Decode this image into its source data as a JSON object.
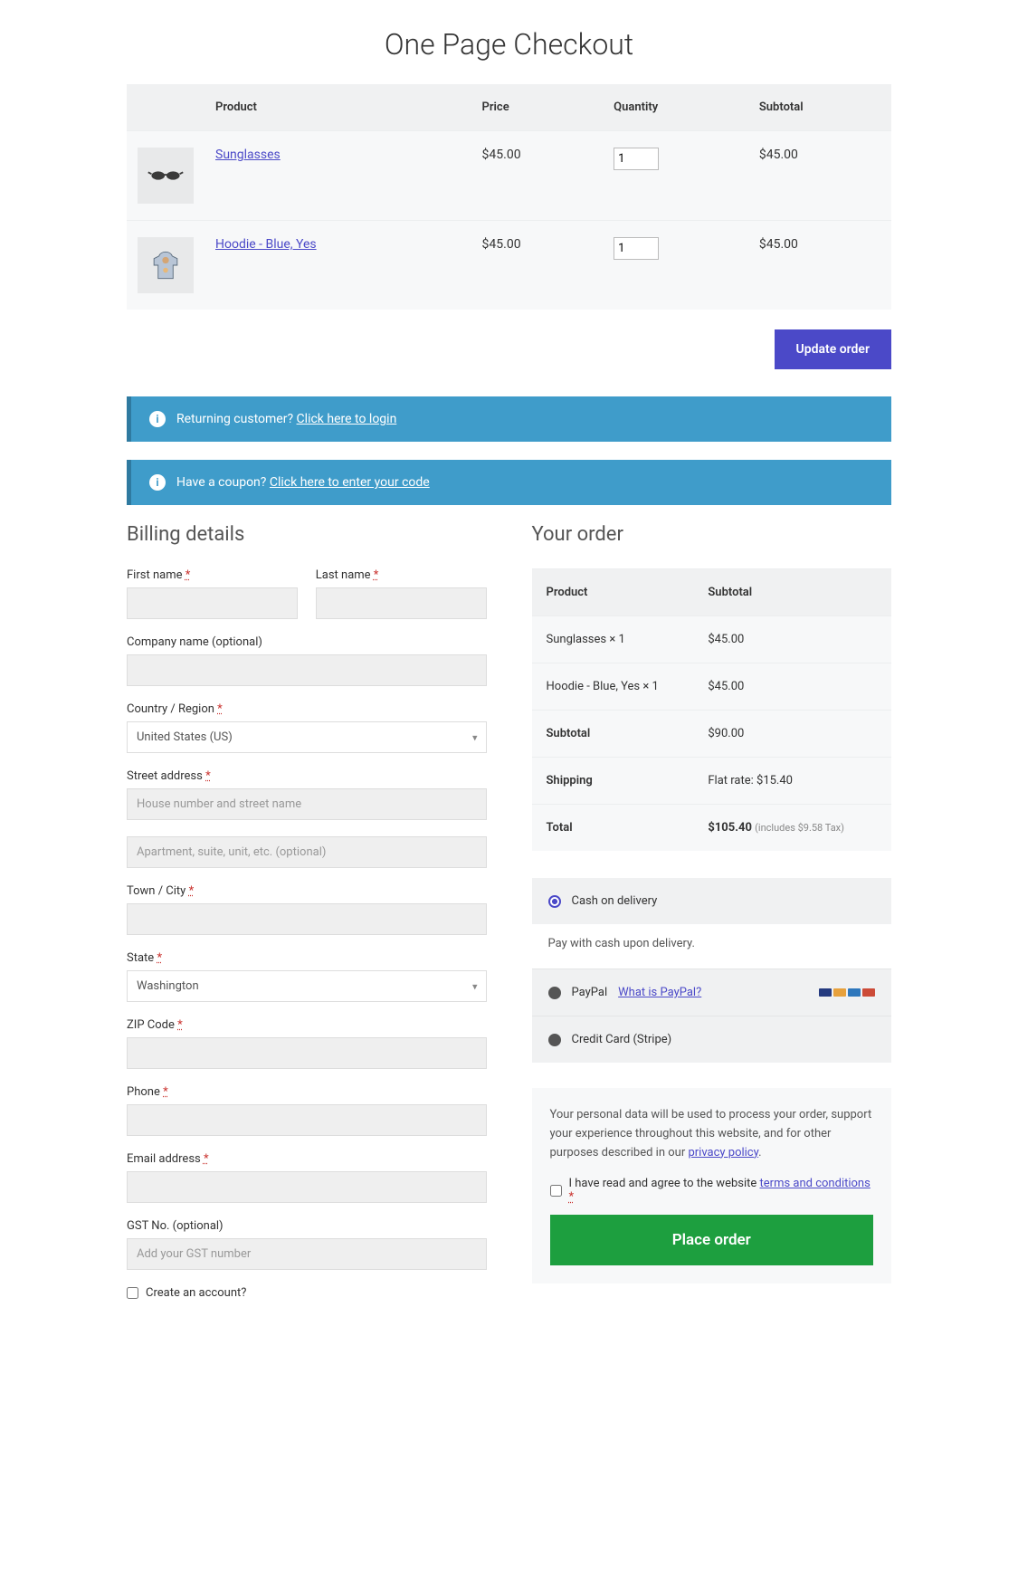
{
  "title": "One Page Checkout",
  "cart": {
    "headers": {
      "product": "Product",
      "price": "Price",
      "qty": "Quantity",
      "subtotal": "Subtotal"
    },
    "items": [
      {
        "name": "Sunglasses",
        "price": "$45.00",
        "qty": "1",
        "subtotal": "$45.00"
      },
      {
        "name": "Hoodie - Blue, Yes",
        "price": "$45.00",
        "qty": "1",
        "subtotal": "$45.00"
      }
    ],
    "update_btn": "Update order"
  },
  "notices": {
    "login_pre": "Returning customer?",
    "login_link": "Click here to login",
    "coupon_pre": "Have a coupon?",
    "coupon_link": "Click here to enter your code"
  },
  "billing": {
    "heading": "Billing details",
    "first_name": "First name",
    "last_name": "Last name",
    "company": "Company name (optional)",
    "country": "Country / Region",
    "country_val": "United States (US)",
    "street": "Street address",
    "street_ph": "House number and street name",
    "street2_ph": "Apartment, suite, unit, etc. (optional)",
    "city": "Town / City",
    "state": "State",
    "state_val": "Washington",
    "zip": "ZIP Code",
    "phone": "Phone",
    "email": "Email address",
    "gst": "GST No. (optional)",
    "gst_ph": "Add your GST number",
    "create_acct": "Create an account?"
  },
  "order": {
    "heading": "Your order",
    "headers": {
      "product": "Product",
      "subtotal": "Subtotal"
    },
    "lines": [
      {
        "name": "Sunglasses  × 1",
        "amount": "$45.00"
      },
      {
        "name": "Hoodie - Blue, Yes  × 1",
        "amount": "$45.00"
      }
    ],
    "subtotal_label": "Subtotal",
    "subtotal": "$90.00",
    "shipping_label": "Shipping",
    "shipping": "Flat rate: $15.40",
    "total_label": "Total",
    "total": "$105.40",
    "tax": "(includes $9.58 Tax)"
  },
  "payment": {
    "cod": "Cash on delivery",
    "cod_desc": "Pay with cash upon delivery.",
    "paypal": "PayPal",
    "paypal_link": "What is PayPal?",
    "stripe": "Credit Card (Stripe)"
  },
  "privacy": {
    "text": "Your personal data will be used to process your order, support your experience throughout this website, and for other purposes described in our ",
    "link": "privacy policy",
    "agree_pre": "I have read and agree to the website ",
    "agree_link": "terms and conditions",
    "place": "Place order"
  },
  "req": "*"
}
